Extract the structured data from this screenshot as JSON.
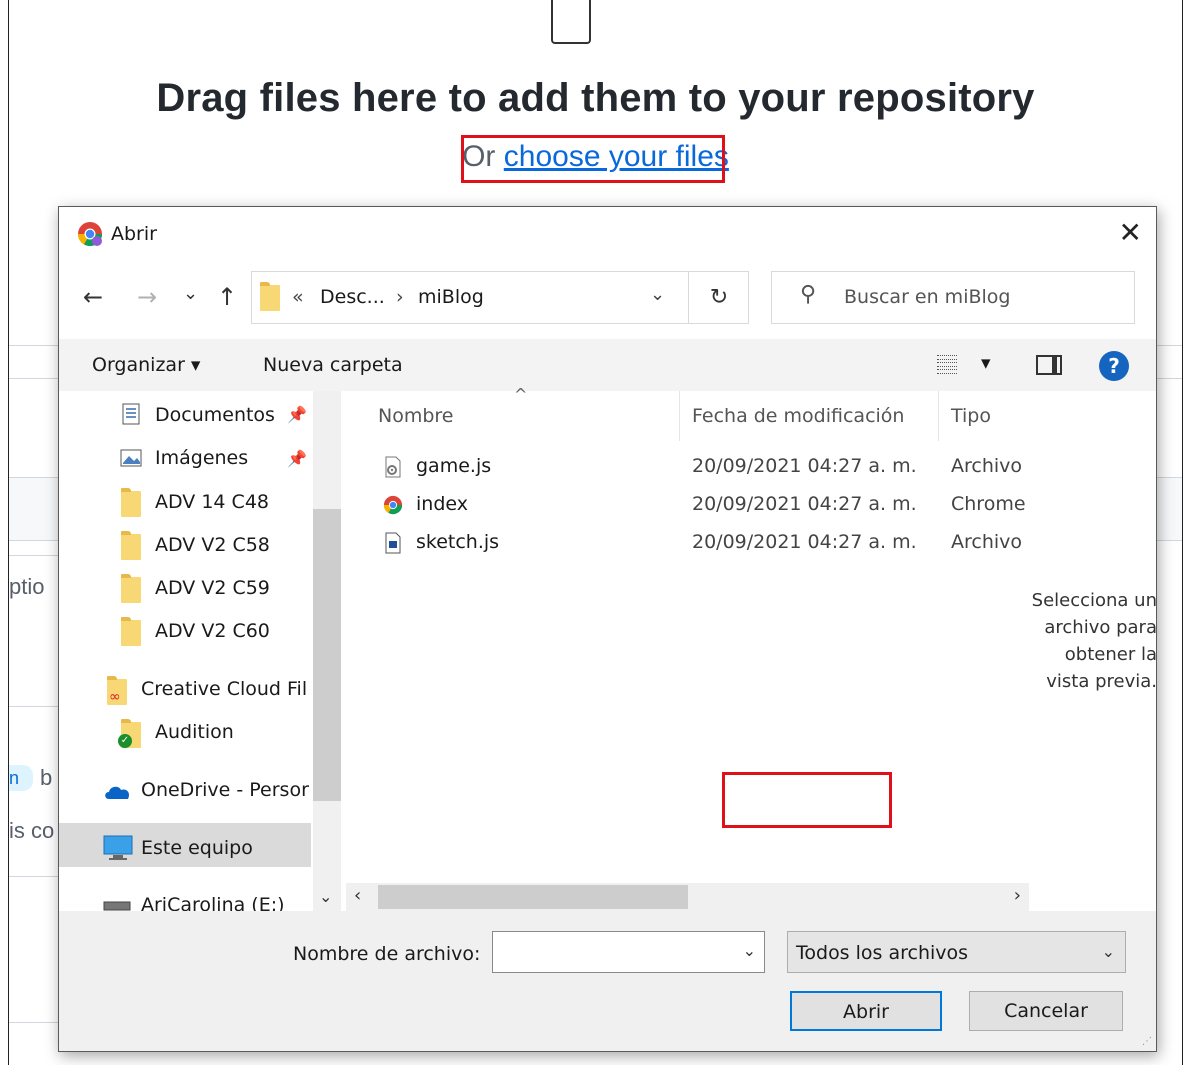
{
  "page": {
    "drag_title": "Drag files here to add them to your repository",
    "or_text": "Or",
    "choose_link": "choose your files",
    "partial_texts": [
      "ptio",
      "n",
      "b",
      "is co"
    ]
  },
  "dialog": {
    "title": "Abrir",
    "close_glyph": "✕",
    "nav": {
      "back": "←",
      "forward": "→",
      "recent": "⌄",
      "up": "↑"
    },
    "address": {
      "overflow": "«",
      "segments": [
        "Desc...",
        "miBlog"
      ],
      "separator": "›",
      "refresh_glyph": "↻"
    },
    "search": {
      "placeholder": "Buscar en miBlog"
    },
    "toolbar": {
      "organize": "Organizar ▾",
      "new_folder": "Nueva carpeta",
      "view_caret": "▾",
      "help": "?"
    },
    "nav_pane": [
      {
        "label": "Documentos",
        "icon": "documents-icon",
        "pinned": true
      },
      {
        "label": "Imágenes",
        "icon": "pictures-icon",
        "pinned": true
      },
      {
        "label": "ADV 14 C48",
        "icon": "folder-icon"
      },
      {
        "label": "ADV V2 C58",
        "icon": "folder-icon"
      },
      {
        "label": "ADV V2 C59",
        "icon": "folder-icon"
      },
      {
        "label": "ADV V2 C60",
        "icon": "folder-icon"
      },
      {
        "label": "Creative Cloud Fil",
        "icon": "creative-cloud-folder-icon"
      },
      {
        "label": "Audition",
        "icon": "audition-folder-icon"
      },
      {
        "label": "OneDrive - Persor",
        "icon": "onedrive-icon"
      },
      {
        "label": "Este equipo",
        "icon": "computer-icon",
        "selected": true
      },
      {
        "label": "AriCarolina (E:)",
        "icon": "drive-icon"
      }
    ],
    "columns": {
      "name": "Nombre",
      "date": "Fecha de modificación",
      "type": "Tipo"
    },
    "files": [
      {
        "name": "game.js",
        "date": "20/09/2021 04:27 a. m.",
        "type": "Archivo",
        "icon": "script-file-icon"
      },
      {
        "name": "index",
        "date": "20/09/2021 04:27 a. m.",
        "type": "Chrome",
        "icon": "chrome-html-icon"
      },
      {
        "name": "sketch.js",
        "date": "20/09/2021 04:27 a. m.",
        "type": "Archivo",
        "icon": "js-file-icon"
      }
    ],
    "preview_text": "Selecciona un archivo para obtener la vista previa.",
    "filename_label": "Nombre de archivo:",
    "filename_value": "",
    "filter_value": "Todos los archivos",
    "open_button": "Abrir",
    "cancel_button": "Cancelar"
  },
  "colors": {
    "highlight": "#e0101a",
    "link": "#0969da",
    "primary_border": "#0078d7",
    "help": "#1565c0"
  }
}
